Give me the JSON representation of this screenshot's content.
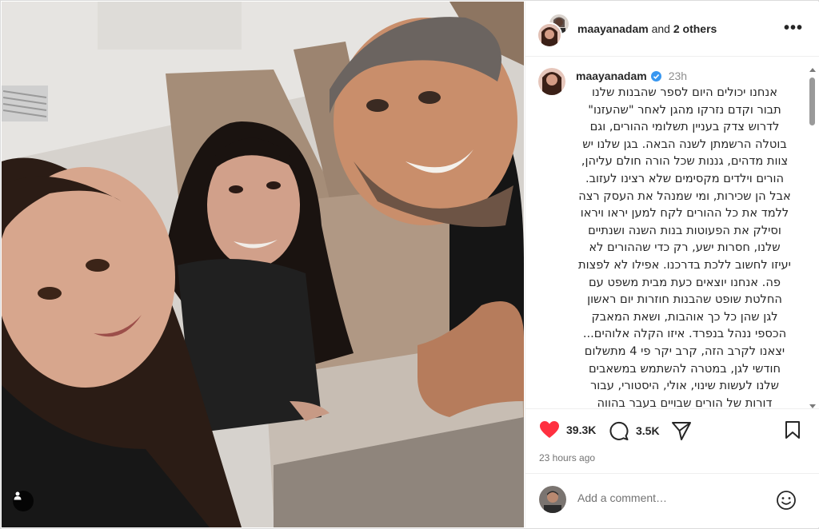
{
  "post": {
    "header_user": "maayanadam",
    "header_and": "and",
    "header_others": "2 others",
    "more_label": "•••",
    "author": "maayanadam",
    "time_short": "23h",
    "caption": "אנחנו יכולים היום לספר שהבנות שלנו\nתבור וקדם נזרקו מהגן לאחר \"שהעזנו\"\nלדרוש צדק בעניין תשלומי ההורים, וגם\nבוטלה הרשמתן לשנה הבאה. בגן שלנו יש\nצוות מדהים, גננות שכל הורה חולם עליהן,\nהורים וילדים מקסימים שלא רצינו לעזוב.\nאבל הן שכירות, ומי שמנהל את העסק רצה\nללמד את כל ההורים לקח למען יראו ויראו\nוסילק את הפעוטות בנות השנה ושנתיים\nשלנו, חסרות ישע, רק כדי שההורים לא\nיעיזו לחשוב ללכת בדרכנו. אפילו לא לפצות\nפה. אנחנו יוצאים כעת מבית משפט עם\nהחלטת שופט שהבנות חוזרות יום ראשון\nלגן שהן כל כך אוהבות, ושאת המאבק\nהכספי ננהל בנפרד. איזו הקלה אלוהים...\nיצאנו לקרב הזה, קרב יקר פי 4 מתשלום\nחודשי לגן, במטרה להשתמש במשאבים\nשלנו לעשות שינוי, אולי, היסטורי, עבור\nדורות של הורים שבויים בעבר בהווה\nובעתיד. אבל הכסף הוא לא המחיר היקר,\nאלא המחיר האישי עבור הבנות שלנו.",
    "likes": "39.3K",
    "comments": "3.5K",
    "posted_time": "23 hours ago",
    "comment_placeholder": "Add a comment…"
  },
  "colors": {
    "like_red": "#ff3040",
    "verified_blue": "#3897f0",
    "border": "#dbdbdb",
    "muted_text": "#737373"
  },
  "icons": [
    "more-icon",
    "verified-icon",
    "heart-icon",
    "comment-icon",
    "share-icon",
    "bookmark-icon",
    "emoji-icon",
    "tag-user-icon"
  ]
}
